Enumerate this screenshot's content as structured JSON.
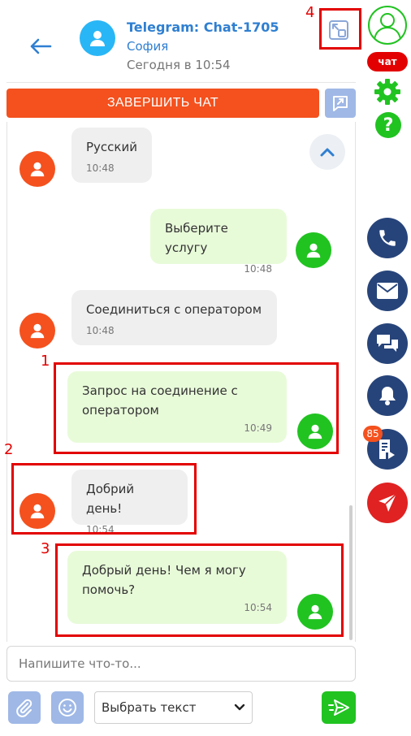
{
  "header": {
    "title": "Telegram: Chat-1705",
    "subtitle": "София",
    "time": "Сегодня в 10:54"
  },
  "actions": {
    "end_chat_label": "ЗАВЕРШИТЬ ЧАТ"
  },
  "messages": [
    {
      "side": "in",
      "text": "Русский",
      "time": "10:48"
    },
    {
      "side": "out",
      "text": "Выберите услугу",
      "time": "10:48"
    },
    {
      "side": "in",
      "text": "Соединиться с оператором",
      "time": "10:48"
    },
    {
      "side": "out",
      "text": "Запрос на соединение с оператором",
      "time": "10:49"
    },
    {
      "side": "in",
      "text": "Добрий день!",
      "time": "10:54"
    },
    {
      "side": "out",
      "text": "Добрый день! Чем я могу помочь?",
      "time": "10:54"
    }
  ],
  "annotations": [
    "1",
    "2",
    "3",
    "4"
  ],
  "composer": {
    "placeholder": "Напишите что-то...",
    "select_value": "Выбрать текст"
  },
  "rail": {
    "chat_badge": "чат",
    "notification_count": "85",
    "icons": [
      "user-icon",
      "gear-icon",
      "help-icon",
      "phone-icon",
      "mail-icon",
      "chat-icon",
      "bell-icon",
      "document-icon",
      "send-icon"
    ]
  },
  "colors": {
    "accent_orange": "#f4511e",
    "accent_green": "#21c321",
    "accent_blue": "#27447a",
    "link_blue": "#2f7fd1",
    "annotation_red": "#e30000"
  }
}
